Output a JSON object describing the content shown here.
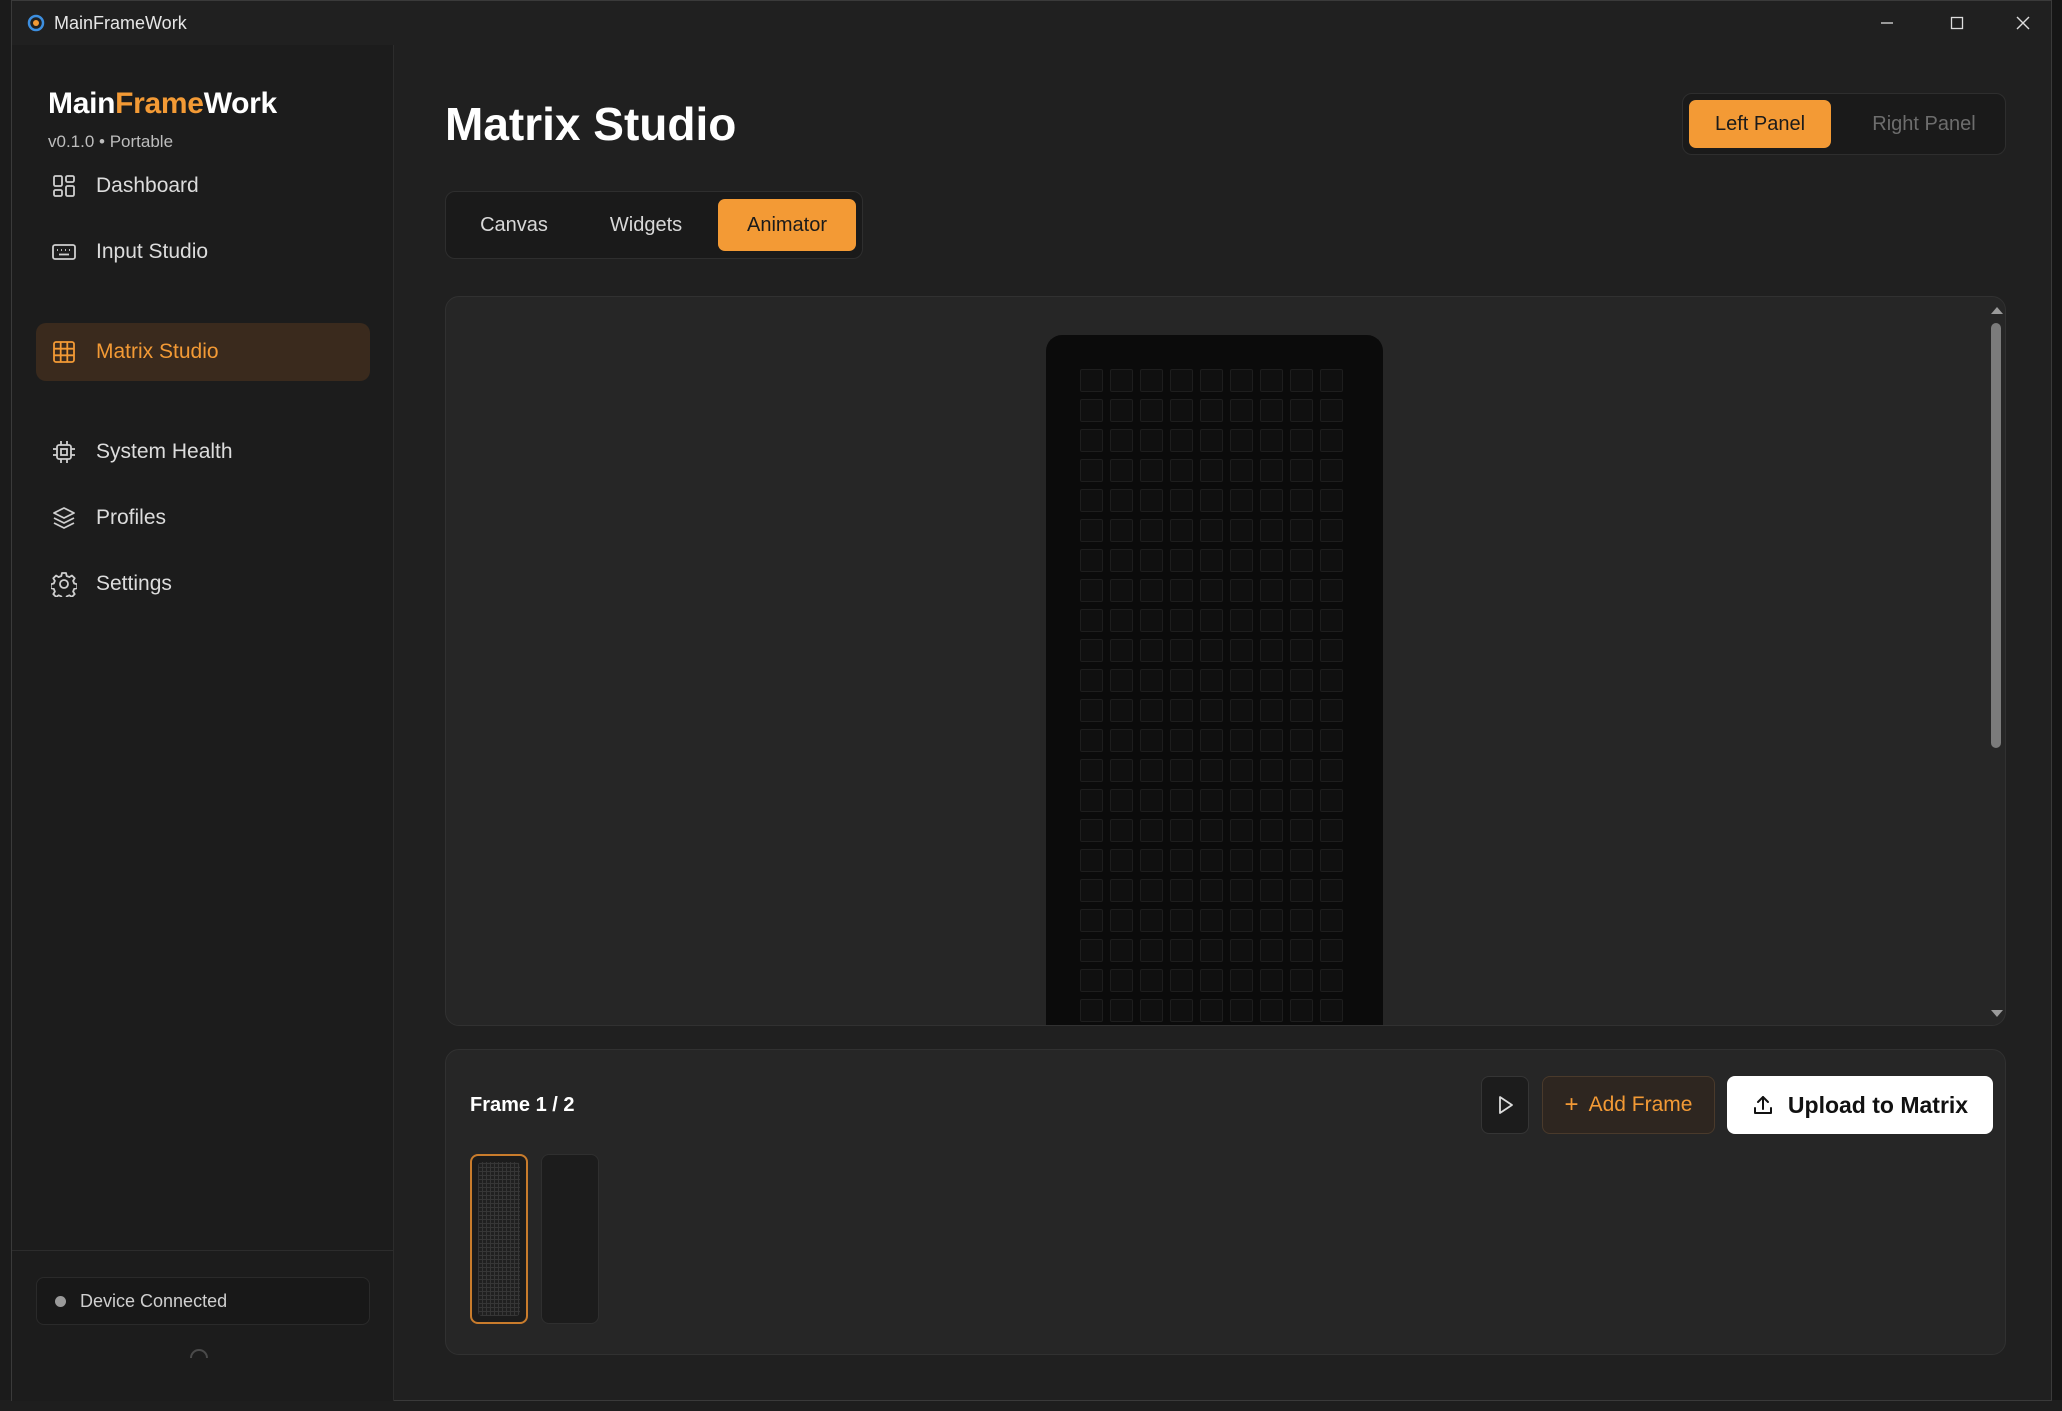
{
  "window": {
    "title": "MainFrameWork"
  },
  "brand": {
    "part1": "Main",
    "part2": "Frame",
    "part3": "Work",
    "version": "v0.1.0 • Portable"
  },
  "sidebar": {
    "items": [
      {
        "label": "Dashboard",
        "icon": "dashboard-icon",
        "active": false
      },
      {
        "label": "Input Studio",
        "icon": "keyboard-icon",
        "active": false
      },
      {
        "label": "Matrix Studio",
        "icon": "grid-icon",
        "active": true
      },
      {
        "label": "System Health",
        "icon": "chip-icon",
        "active": false
      },
      {
        "label": "Profiles",
        "icon": "layers-icon",
        "active": false
      },
      {
        "label": "Settings",
        "icon": "gear-icon",
        "active": false
      }
    ],
    "device_status": "Device Connected"
  },
  "header": {
    "title": "Matrix Studio"
  },
  "panel_toggle": {
    "left": "Left Panel",
    "right": "Right Panel",
    "selected": "Left Panel"
  },
  "tabs": [
    {
      "label": "Canvas"
    },
    {
      "label": "Widgets"
    },
    {
      "label": "Animator",
      "active": true
    }
  ],
  "matrix": {
    "columns": 9,
    "visible_rows": 23
  },
  "animator": {
    "frame_label": "Frame 1 / 2",
    "add_frame_label": "Add Frame",
    "upload_label": "Upload to Matrix",
    "frames": [
      {
        "index": 1,
        "selected": true
      },
      {
        "index": 2,
        "selected": false
      }
    ]
  },
  "colors": {
    "accent": "#f39a35",
    "background": "#202020",
    "panel": "#262626",
    "sidebar": "#1c1c1c"
  }
}
